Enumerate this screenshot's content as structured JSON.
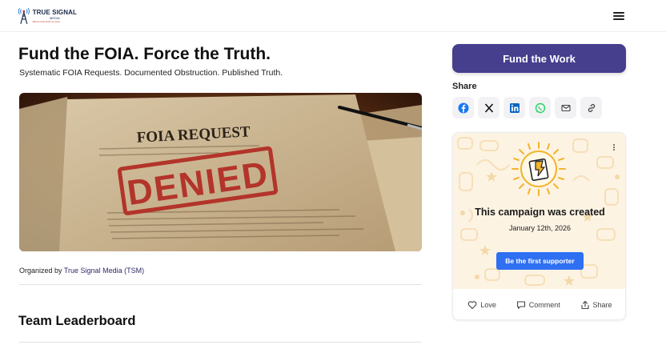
{
  "header": {
    "logo_title": "TRUE SIGNAL",
    "logo_sub": "MEDIA",
    "logo_tag": "Where truth finds its voice"
  },
  "main": {
    "title": "Fund the FOIA. Force the Truth.",
    "subtitle": "Systematic FOIA Requests. Documented Obstruction. Published Truth.",
    "hero": {
      "header_text": "FOIA REQUEST",
      "stamp_text": "DENIED"
    },
    "organizer_prefix": "Organized by ",
    "organizer_name": "True Signal Media (TSM)",
    "leaderboard_title": "Team Leaderboard"
  },
  "sidebar": {
    "fund_button": "Fund the Work",
    "share_label": "Share",
    "share_buttons": [
      {
        "icon": "facebook-icon"
      },
      {
        "icon": "x-icon"
      },
      {
        "icon": "linkedin-icon"
      },
      {
        "icon": "whatsapp-icon"
      },
      {
        "icon": "mail-icon"
      },
      {
        "icon": "link-icon"
      }
    ],
    "card": {
      "title": "This campaign was created",
      "date": "January 12th, 2026",
      "support_button": "Be the first supporter",
      "actions": {
        "love": "Love",
        "comment": "Comment",
        "share": "Share"
      }
    }
  },
  "colors": {
    "accent": "#463f8e",
    "support_blue": "#2f6ff2",
    "card_bg": "#fdf3e3"
  }
}
